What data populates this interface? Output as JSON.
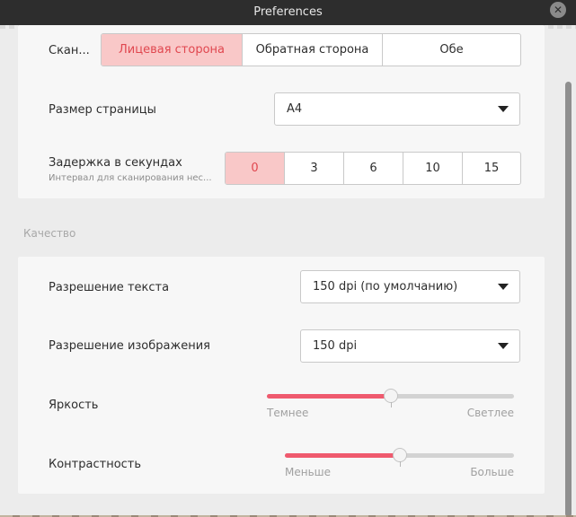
{
  "window": {
    "title": "Preferences"
  },
  "scan": {
    "sides_label": "Скан...",
    "sides": [
      "Лицевая сторона",
      "Обратная сторона",
      "Обе"
    ],
    "page_size_label": "Размер страницы",
    "page_size_value": "A4",
    "delay_label": "Задержка в секундах",
    "delay_sublabel": "Интервал для сканирования нес...",
    "delay_options": [
      "0",
      "3",
      "6",
      "10",
      "15"
    ]
  },
  "quality": {
    "section_title": "Качество",
    "text_res_label": "Разрешение текста",
    "text_res_value": "150 dpi (по умолчанию)",
    "image_res_label": "Разрешение изображения",
    "image_res_value": "150 dpi",
    "brightness_label": "Яркость",
    "brightness_min_label": "Темнее",
    "brightness_max_label": "Светлее",
    "brightness_level": 0.5,
    "contrast_label": "Контрастность",
    "contrast_min_label": "Меньше",
    "contrast_max_label": "Больше",
    "contrast_level": 0.5
  },
  "colors": {
    "accent": "#ef5a6e",
    "active_bg": "#f9c8c8",
    "active_text": "#e0474f"
  }
}
